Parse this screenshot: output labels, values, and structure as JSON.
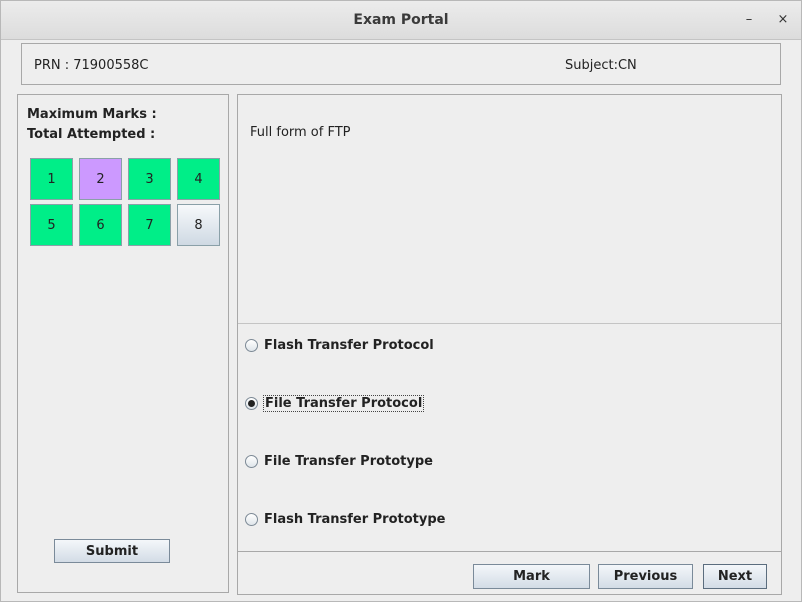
{
  "window": {
    "title": "Exam Portal",
    "minimize_glyph": "–",
    "close_glyph": "×"
  },
  "header": {
    "prn": "PRN : 71900558C",
    "subject": "Subject:CN"
  },
  "sidebar": {
    "max_marks": "Maximum Marks :",
    "total_attempted": "Total Attempted :",
    "questions": [
      {
        "label": "1",
        "status": "attempted",
        "color": "#00ee88"
      },
      {
        "label": "2",
        "status": "marked",
        "color": "#cc99ff"
      },
      {
        "label": "3",
        "status": "attempted",
        "color": "#00ee88"
      },
      {
        "label": "4",
        "status": "attempted",
        "color": "#00ee88"
      },
      {
        "label": "5",
        "status": "attempted",
        "color": "#00ee88"
      },
      {
        "label": "6",
        "status": "attempted",
        "color": "#00ee88"
      },
      {
        "label": "7",
        "status": "attempted",
        "color": "#00ee88"
      },
      {
        "label": "8",
        "status": "current",
        "color": "#e4eaf0"
      }
    ],
    "submit_label": "Submit"
  },
  "question": {
    "text": "Full form of FTP",
    "options": [
      {
        "label": "Flash Transfer Protocol",
        "selected": false
      },
      {
        "label": "File Transfer Protocol",
        "selected": true
      },
      {
        "label": "File Transfer Prototype",
        "selected": false
      },
      {
        "label": "Flash Transfer Prototype",
        "selected": false
      }
    ]
  },
  "buttons": {
    "mark_label": "Mark",
    "previous_label": "Previous",
    "next_label": "Next"
  }
}
